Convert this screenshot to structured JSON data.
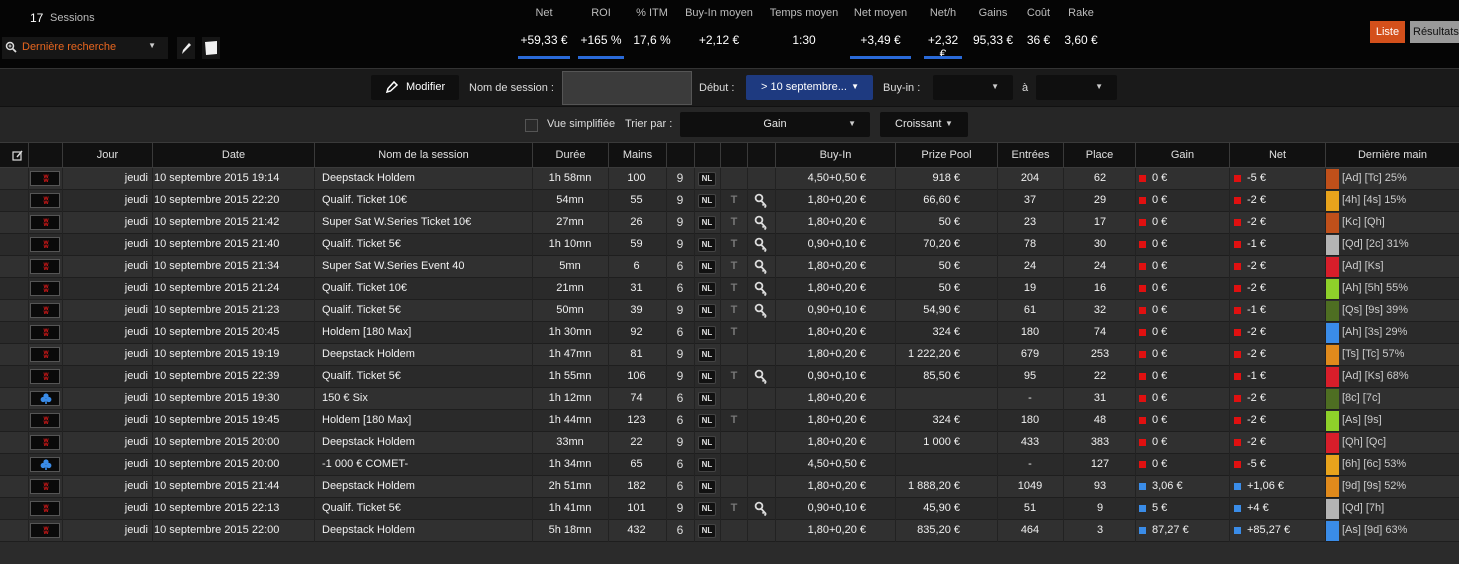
{
  "header": {
    "sessions_count": "17",
    "sessions_label": "Sessions",
    "search_label": "Dernière recherche",
    "view_buttons": {
      "list": "Liste",
      "results": "Résultats"
    }
  },
  "stats": [
    {
      "label": "Net",
      "value": "+59,33 €",
      "highlight": true
    },
    {
      "label": "ROI",
      "value": "+165 %",
      "highlight": true
    },
    {
      "label": "% ITM",
      "value": "17,6 %",
      "highlight": false
    },
    {
      "label": "Buy-In moyen",
      "value": "+2,12 €",
      "highlight": false
    },
    {
      "label": "Temps moyen",
      "value": "1:30",
      "highlight": false
    },
    {
      "label": "Net moyen",
      "value": "+3,49 €",
      "highlight": true
    },
    {
      "label": "Net/h",
      "value": "+2,32 €",
      "highlight": true
    },
    {
      "label": "Gains",
      "value": "95,33 €",
      "highlight": false
    },
    {
      "label": "Coût",
      "value": "36 €",
      "highlight": false
    },
    {
      "label": "Rake",
      "value": "3,60 €",
      "highlight": false
    }
  ],
  "filters": {
    "modify_label": "Modifier",
    "session_name_label": "Nom de session :",
    "session_name_value": "",
    "debut_label": "Début :",
    "debut_value": "> 10 septembre...",
    "buyin_label": "Buy-in :",
    "buyin_from": "",
    "to_label": "à",
    "buyin_to": ""
  },
  "view": {
    "simple_label": "Vue simplifiée",
    "sort_label": "Trier par :",
    "sort_value": "Gain",
    "order_value": "Croissant"
  },
  "columns": {
    "jour": "Jour",
    "date": "Date",
    "name": "Nom de la session",
    "duree": "Durée",
    "mains": "Mains",
    "buyin": "Buy-In",
    "prize": "Prize Pool",
    "entrees": "Entrées",
    "place": "Place",
    "gain": "Gain",
    "net": "Net",
    "last_hand": "Dernière main"
  },
  "colors": {
    "accent_blue": "#2a6ad8",
    "accent_orange": "#d4501b",
    "loss_red": "#e01010",
    "win_blue": "#3a8ce8"
  },
  "rows": [
    {
      "site": "w",
      "jour": "jeudi",
      "date": "10 septembre 2015 19:14",
      "name": "Deepstack Holdem",
      "duree": "1h 58mn",
      "mains": "100",
      "players": "9",
      "nl": "NL",
      "t": "",
      "key": false,
      "buyin": "4,50+0,50 €",
      "prize": "918 €",
      "entrees": "204",
      "place": "62",
      "gain": "0 €",
      "net": "-5 €",
      "result": "loss",
      "hand_color": "#c0501a",
      "hand": "[Ad] [Tc]  25%"
    },
    {
      "site": "w",
      "jour": "jeudi",
      "date": "10 septembre 2015 22:20",
      "name": "Qualif. Ticket 10€",
      "duree": "54mn",
      "mains": "55",
      "players": "9",
      "nl": "NL",
      "t": "T",
      "key": true,
      "buyin": "1,80+0,20 €",
      "prize": "66,60 €",
      "entrees": "37",
      "place": "29",
      "gain": "0 €",
      "net": "-2 €",
      "result": "loss",
      "hand_color": "#e8a31c",
      "hand": "[4h] [4s]  15%"
    },
    {
      "site": "w",
      "jour": "jeudi",
      "date": "10 septembre 2015 21:42",
      "name": "Super Sat W.Series Ticket 10€",
      "duree": "27mn",
      "mains": "26",
      "players": "9",
      "nl": "NL",
      "t": "T",
      "key": true,
      "buyin": "1,80+0,20 €",
      "prize": "50 €",
      "entrees": "23",
      "place": "17",
      "gain": "0 €",
      "net": "-2 €",
      "result": "loss",
      "hand_color": "#c0501a",
      "hand": "[Kc] [Qh]"
    },
    {
      "site": "w",
      "jour": "jeudi",
      "date": "10 septembre 2015 21:40",
      "name": "Qualif. Ticket 5€",
      "duree": "1h 10mn",
      "mains": "59",
      "players": "9",
      "nl": "NL",
      "t": "T",
      "key": true,
      "buyin": "0,90+0,10 €",
      "prize": "70,20 €",
      "entrees": "78",
      "place": "30",
      "gain": "0 €",
      "net": "-1 €",
      "result": "loss",
      "hand_color": "#b4b4b4",
      "hand": "[Qd] [2c]  31%"
    },
    {
      "site": "w",
      "jour": "jeudi",
      "date": "10 septembre 2015 21:34",
      "name": "Super Sat W.Series Event 40",
      "duree": "5mn",
      "mains": "6",
      "players": "6",
      "nl": "NL",
      "t": "T",
      "key": true,
      "buyin": "1,80+0,20 €",
      "prize": "50 €",
      "entrees": "24",
      "place": "24",
      "gain": "0 €",
      "net": "-2 €",
      "result": "loss",
      "hand_color": "#d81e2a",
      "hand": "[Ad] [Ks]"
    },
    {
      "site": "w",
      "jour": "jeudi",
      "date": "10 septembre 2015 21:24",
      "name": "Qualif. Ticket 10€",
      "duree": "21mn",
      "mains": "31",
      "players": "6",
      "nl": "NL",
      "t": "T",
      "key": true,
      "buyin": "1,80+0,20 €",
      "prize": "50 €",
      "entrees": "19",
      "place": "16",
      "gain": "0 €",
      "net": "-2 €",
      "result": "loss",
      "hand_color": "#8ed02a",
      "hand": "[Ah] [5h]  55%"
    },
    {
      "site": "w",
      "jour": "jeudi",
      "date": "10 septembre 2015 21:23",
      "name": "Qualif. Ticket 5€",
      "duree": "50mn",
      "mains": "39",
      "players": "9",
      "nl": "NL",
      "t": "T",
      "key": true,
      "buyin": "0,90+0,10 €",
      "prize": "54,90 €",
      "entrees": "61",
      "place": "32",
      "gain": "0 €",
      "net": "-1 €",
      "result": "loss",
      "hand_color": "#4e6e22",
      "hand": "[Qs] [9s]  39%"
    },
    {
      "site": "w",
      "jour": "jeudi",
      "date": "10 septembre 2015 20:45",
      "name": "Holdem [180 Max]",
      "duree": "1h 30mn",
      "mains": "92",
      "players": "6",
      "nl": "NL",
      "t": "T",
      "key": false,
      "buyin": "1,80+0,20 €",
      "prize": "324 €",
      "entrees": "180",
      "place": "74",
      "gain": "0 €",
      "net": "-2 €",
      "result": "loss",
      "hand_color": "#3a8ce8",
      "hand": "[Ah] [3s]  29%"
    },
    {
      "site": "w",
      "jour": "jeudi",
      "date": "10 septembre 2015 19:19",
      "name": "Deepstack Holdem",
      "duree": "1h 47mn",
      "mains": "81",
      "players": "9",
      "nl": "NL",
      "t": "",
      "key": false,
      "buyin": "1,80+0,20 €",
      "prize": "1 222,20 €",
      "entrees": "679",
      "place": "253",
      "gain": "0 €",
      "net": "-2 €",
      "result": "loss",
      "hand_color": "#e08a1c",
      "hand": "[Ts] [Tc]  57%"
    },
    {
      "site": "w",
      "jour": "jeudi",
      "date": "10 septembre 2015 22:39",
      "name": "Qualif. Ticket 5€",
      "duree": "1h 55mn",
      "mains": "106",
      "players": "9",
      "nl": "NL",
      "t": "T",
      "key": true,
      "buyin": "0,90+0,10 €",
      "prize": "85,50 €",
      "entrees": "95",
      "place": "22",
      "gain": "0 €",
      "net": "-1 €",
      "result": "loss",
      "hand_color": "#d81e2a",
      "hand": "[Ad] [Ks]  68%"
    },
    {
      "site": "c",
      "jour": "jeudi",
      "date": "10 septembre 2015 19:30",
      "name": "150 € Six",
      "duree": "1h 12mn",
      "mains": "74",
      "players": "6",
      "nl": "NL",
      "t": "",
      "key": false,
      "buyin": "1,80+0,20 €",
      "prize": "",
      "entrees": "-",
      "place": "31",
      "gain": "0 €",
      "net": "-2 €",
      "result": "loss",
      "hand_color": "#4e6e22",
      "hand": "[8c] [7c]"
    },
    {
      "site": "w",
      "jour": "jeudi",
      "date": "10 septembre 2015 19:45",
      "name": "Holdem [180 Max]",
      "duree": "1h 44mn",
      "mains": "123",
      "players": "6",
      "nl": "NL",
      "t": "T",
      "key": false,
      "buyin": "1,80+0,20 €",
      "prize": "324 €",
      "entrees": "180",
      "place": "48",
      "gain": "0 €",
      "net": "-2 €",
      "result": "loss",
      "hand_color": "#8ed02a",
      "hand": "[As] [9s]"
    },
    {
      "site": "w",
      "jour": "jeudi",
      "date": "10 septembre 2015 20:00",
      "name": "Deepstack Holdem",
      "duree": "33mn",
      "mains": "22",
      "players": "9",
      "nl": "NL",
      "t": "",
      "key": false,
      "buyin": "1,80+0,20 €",
      "prize": "1 000 €",
      "entrees": "433",
      "place": "383",
      "gain": "0 €",
      "net": "-2 €",
      "result": "loss",
      "hand_color": "#d81e2a",
      "hand": "[Qh] [Qc]"
    },
    {
      "site": "c",
      "jour": "jeudi",
      "date": "10 septembre 2015 20:00",
      "name": "-1 000 € COMET-",
      "duree": "1h 34mn",
      "mains": "65",
      "players": "6",
      "nl": "NL",
      "t": "",
      "key": false,
      "buyin": "4,50+0,50 €",
      "prize": "",
      "entrees": "-",
      "place": "127",
      "gain": "0 €",
      "net": "-5 €",
      "result": "loss",
      "hand_color": "#e8a31c",
      "hand": "[6h] [6c]  53%"
    },
    {
      "site": "w",
      "jour": "jeudi",
      "date": "10 septembre 2015 21:44",
      "name": "Deepstack Holdem",
      "duree": "2h 51mn",
      "mains": "182",
      "players": "6",
      "nl": "NL",
      "t": "",
      "key": false,
      "buyin": "1,80+0,20 €",
      "prize": "1 888,20 €",
      "entrees": "1049",
      "place": "93",
      "gain": "3,06 €",
      "net": "+1,06 €",
      "result": "win",
      "hand_color": "#e08a1c",
      "hand": "[9d] [9s]  52%"
    },
    {
      "site": "w",
      "jour": "jeudi",
      "date": "10 septembre 2015 22:13",
      "name": "Qualif. Ticket 5€",
      "duree": "1h 41mn",
      "mains": "101",
      "players": "9",
      "nl": "NL",
      "t": "T",
      "key": true,
      "buyin": "0,90+0,10 €",
      "prize": "45,90 €",
      "entrees": "51",
      "place": "9",
      "gain": "5 €",
      "net": "+4 €",
      "result": "win",
      "hand_color": "#b4b4b4",
      "hand": "[Qd] [7h]"
    },
    {
      "site": "w",
      "jour": "jeudi",
      "date": "10 septembre 2015 22:00",
      "name": "Deepstack Holdem",
      "duree": "5h 18mn",
      "mains": "432",
      "players": "6",
      "nl": "NL",
      "t": "",
      "key": false,
      "buyin": "1,80+0,20 €",
      "prize": "835,20 €",
      "entrees": "464",
      "place": "3",
      "gain": "87,27 €",
      "net": "+85,27 €",
      "result": "win",
      "hand_color": "#3a8ce8",
      "hand": "[As] [9d]  63%"
    }
  ]
}
